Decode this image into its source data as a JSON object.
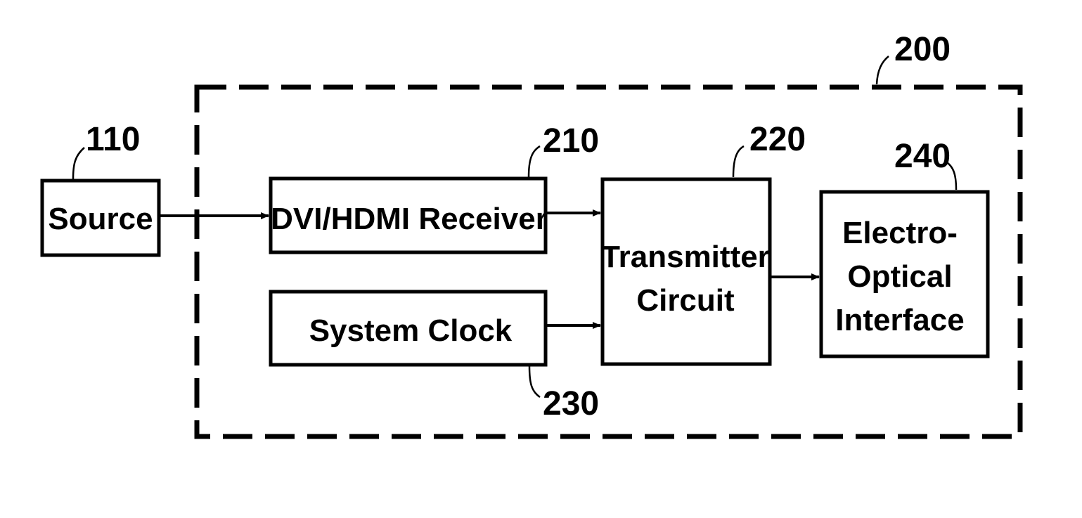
{
  "diagram": {
    "type": "block-diagram",
    "container": {
      "ref": "200",
      "style": "dashed"
    },
    "blocks": [
      {
        "id": "source",
        "ref": "110",
        "lines": [
          "Source"
        ]
      },
      {
        "id": "receiver",
        "ref": "210",
        "lines": [
          "DVI/HDMI Receiver"
        ]
      },
      {
        "id": "clock",
        "ref": "230",
        "lines": [
          "System Clock"
        ]
      },
      {
        "id": "transmitter",
        "ref": "220",
        "lines": [
          "Transmitter",
          "Circuit"
        ]
      },
      {
        "id": "eo-interface",
        "ref": "240",
        "lines": [
          "Electro-",
          "Optical",
          "Interface"
        ]
      }
    ],
    "connections": [
      {
        "from": "Source",
        "to": "DVI/HDMI Receiver"
      },
      {
        "from": "DVI/HDMI Receiver",
        "to": "Transmitter Circuit"
      },
      {
        "from": "System Clock",
        "to": "Transmitter Circuit"
      },
      {
        "from": "Transmitter Circuit",
        "to": "Electro-Optical Interface"
      }
    ]
  }
}
